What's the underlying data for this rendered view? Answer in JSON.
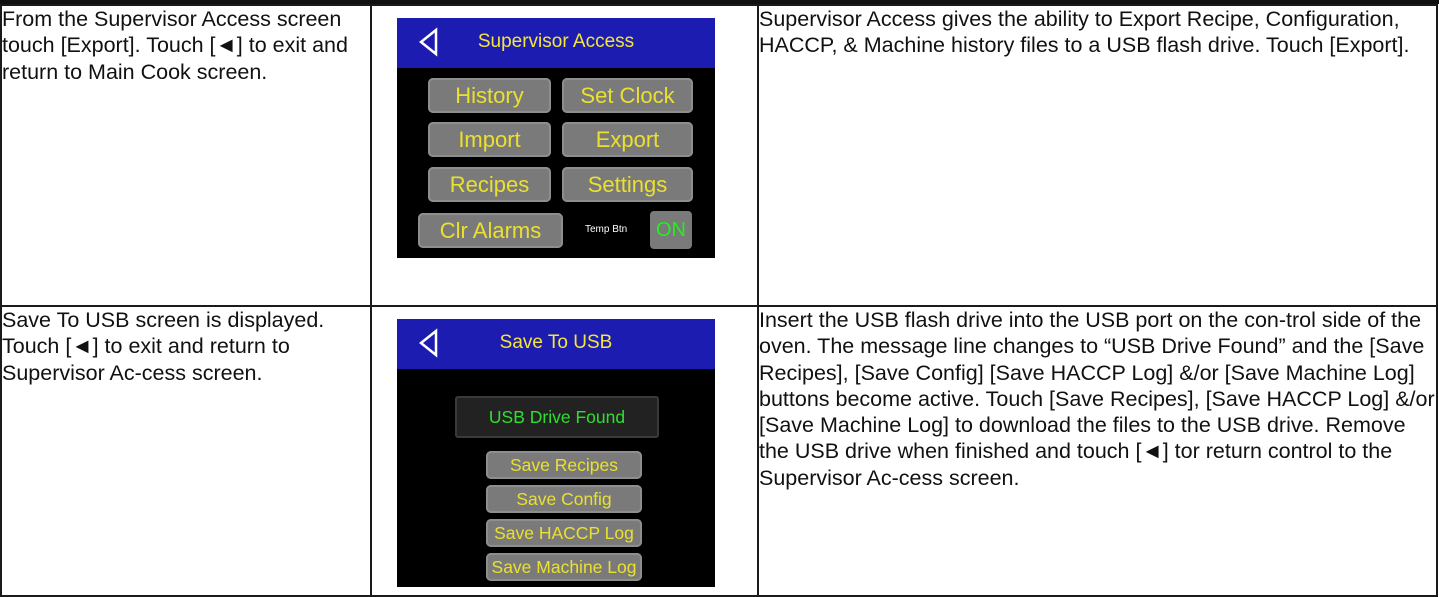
{
  "rows": [
    {
      "left_text": "From the Supervisor Access screen touch [Export]. Touch [◄] to exit and return to Main Cook screen.",
      "right_text": "Supervisor Access gives the ability to Export Recipe, Configuration, HACCP, & Machine history files to a USB flash drive. Touch [Export].",
      "screen": {
        "title": "Supervisor Access",
        "buttons": [
          "History",
          "Set Clock",
          "Import",
          "Export",
          "Recipes",
          "Settings",
          "Clr Alarms"
        ],
        "temp_label": "Temp Btn",
        "temp_value": "ON"
      }
    },
    {
      "left_text": "Save To USB screen is displayed. Touch [◄] to exit and return to Supervisor Ac-cess screen.",
      "right_text": "Insert the USB flash drive into the USB port on the con-trol side of the oven. The message line changes to “USB Drive Found” and the [Save Recipes], [Save Config] [Save HACCP Log] &/or [Save Machine Log] buttons become active. Touch [Save Recipes], [Save HACCP Log] &/or [Save Machine Log] to download the files to the USB drive. Remove the USB drive when finished and touch [◄] tor return control to the Supervisor Ac-cess screen.",
      "screen": {
        "title": "Save To USB",
        "message": "USB Drive Found",
        "buttons": [
          "Save Recipes",
          "Save Config",
          "Save HACCP Log",
          "Save Machine Log"
        ]
      }
    }
  ],
  "colors": {
    "header_blue": "#1c1cb0",
    "button_text": "#eae030",
    "status_green": "#2ee02e",
    "button_gray": "#7a7a7a"
  },
  "icons": {
    "back": "back-triangle-icon"
  }
}
